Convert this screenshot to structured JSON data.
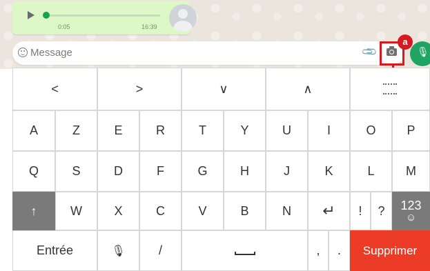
{
  "voice_message": {
    "elapsed_time": "0:05",
    "sent_time": "16:39",
    "progress": 0.03,
    "play_icon": "play-icon",
    "mic_icon": "mic-icon"
  },
  "message_bar": {
    "placeholder": "Message",
    "emoji_icon": "emoji-icon",
    "attach_icon": "paperclip-icon",
    "camera_icon": "camera-icon",
    "mic_icon": "mic-icon"
  },
  "annotation": {
    "badge": "a",
    "color": "#d71920"
  },
  "keyboard": {
    "nav_row": [
      "<",
      ">",
      "∨",
      "∧"
    ],
    "row1": [
      "A",
      "Z",
      "E",
      "R",
      "T",
      "Y",
      "U",
      "I",
      "O",
      "P"
    ],
    "row2": [
      "Q",
      "S",
      "D",
      "F",
      "G",
      "H",
      "J",
      "K",
      "L",
      "M"
    ],
    "row3": [
      "↑",
      "W",
      "X",
      "C",
      "V",
      "B",
      "N",
      "↵",
      "!",
      "?"
    ],
    "numbers_key": "123",
    "numbers_key_sub": "☺",
    "bottom_row": {
      "enter": "Entrée",
      "slash": "/",
      "comma": ",",
      "period": ".",
      "delete": "Supprimer"
    },
    "delete_color": "#ec3b27"
  },
  "colors": {
    "send_button": "#1fa463",
    "bubble": "#dcf8c6"
  }
}
